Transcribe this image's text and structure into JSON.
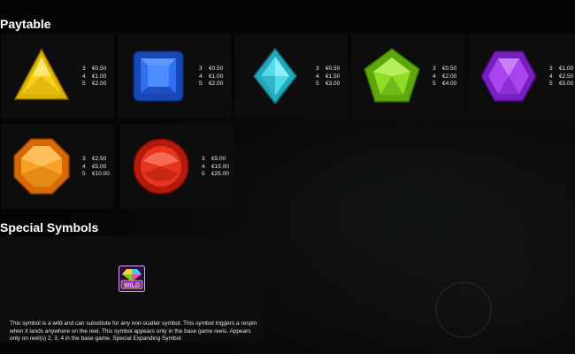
{
  "paytable": {
    "title": "Paytable",
    "symbols": [
      {
        "icon": "yellow-triangle-gem-icon",
        "color": "#f2c811",
        "pays": [
          {
            "count": "3",
            "amount": "€0.50"
          },
          {
            "count": "4",
            "amount": "€1.00"
          },
          {
            "count": "5",
            "amount": "€2.00"
          }
        ]
      },
      {
        "icon": "blue-square-gem-icon",
        "color": "#1f5fe0",
        "pays": [
          {
            "count": "3",
            "amount": "€0.50"
          },
          {
            "count": "4",
            "amount": "€1.00"
          },
          {
            "count": "5",
            "amount": "€2.00"
          }
        ]
      },
      {
        "icon": "cyan-diamond-gem-icon",
        "color": "#3cc8d8",
        "pays": [
          {
            "count": "3",
            "amount": "€0.50"
          },
          {
            "count": "4",
            "amount": "€1.50"
          },
          {
            "count": "5",
            "amount": "€3.00"
          }
        ]
      },
      {
        "icon": "green-pentagon-gem-icon",
        "color": "#7ccc18",
        "pays": [
          {
            "count": "3",
            "amount": "€0.50"
          },
          {
            "count": "4",
            "amount": "€2.00"
          },
          {
            "count": "5",
            "amount": "€4.00"
          }
        ]
      },
      {
        "icon": "purple-hexagon-gem-icon",
        "color": "#9b2be0",
        "pays": [
          {
            "count": "3",
            "amount": "€1.00"
          },
          {
            "count": "4",
            "amount": "€2.50"
          },
          {
            "count": "5",
            "amount": "€5.00"
          }
        ]
      },
      {
        "icon": "orange-octagon-gem-icon",
        "color": "#f08a10",
        "pays": [
          {
            "count": "3",
            "amount": "€2.50"
          },
          {
            "count": "4",
            "amount": "€5.00"
          },
          {
            "count": "5",
            "amount": "€10.00"
          }
        ]
      },
      {
        "icon": "red-round-gem-icon",
        "color": "#d92a18",
        "pays": [
          {
            "count": "3",
            "amount": "€5.00"
          },
          {
            "count": "4",
            "amount": "€15.00"
          },
          {
            "count": "5",
            "amount": "€25.00"
          }
        ]
      }
    ]
  },
  "special": {
    "title": "Special Symbols",
    "wild": {
      "icon": "wild-gem-icon",
      "label": "WILD",
      "description": "This symbol is a wild and can substitute for any non-scatter symbol. This symbol triggers a respin when it lands anywhere on the reel. This symbol appears only in the base game reels. Appears only on reel(s) 2, 3, 4 in the base game. Special Expanding Symbol"
    }
  }
}
